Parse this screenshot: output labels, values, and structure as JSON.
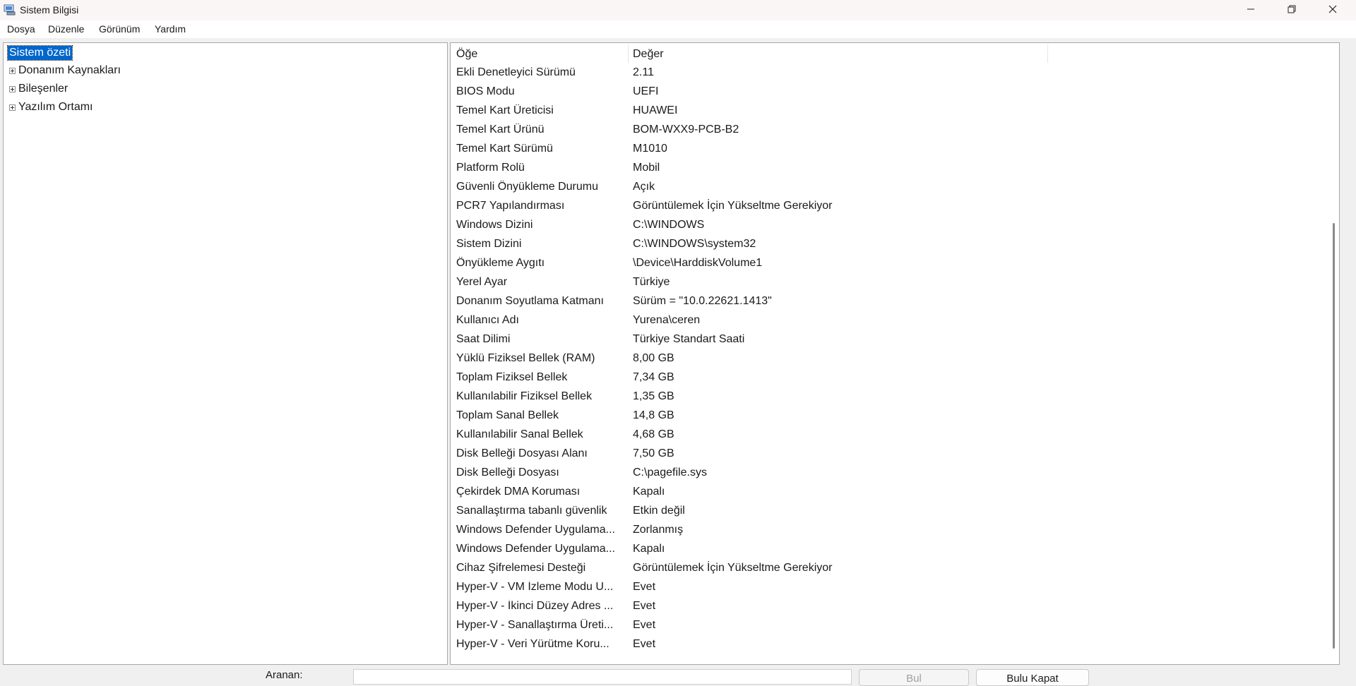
{
  "window": {
    "title": "Sistem Bilgisi",
    "app_icon": "system-information-icon",
    "controls": [
      "minimize-icon",
      "maximize-icon",
      "close-icon"
    ]
  },
  "menu": [
    "Dosya",
    "Düzenle",
    "Görünüm",
    "Yardım"
  ],
  "tree": {
    "root": "Sistem özeti",
    "children": [
      "Donanım Kaynakları",
      "Bileşenler",
      "Yazılım Ortamı"
    ]
  },
  "table": {
    "columns": [
      "Öğe",
      "Değer"
    ],
    "rows": [
      [
        "Ekli Denetleyici Sürümü",
        "2.11"
      ],
      [
        "BIOS Modu",
        "UEFI"
      ],
      [
        "Temel Kart Üreticisi",
        "HUAWEI"
      ],
      [
        "Temel Kart Ürünü",
        "BOM-WXX9-PCB-B2"
      ],
      [
        "Temel Kart Sürümü",
        "M1010"
      ],
      [
        "Platform Rolü",
        "Mobil"
      ],
      [
        "Güvenli Önyükleme Durumu",
        "Açık"
      ],
      [
        "PCR7 Yapılandırması",
        "Görüntülemek İçin Yükseltme Gerekiyor"
      ],
      [
        "Windows Dizini",
        "C:\\WINDOWS"
      ],
      [
        "Sistem Dizini",
        "C:\\WINDOWS\\system32"
      ],
      [
        "Önyükleme Aygıtı",
        "\\Device\\HarddiskVolume1"
      ],
      [
        "Yerel Ayar",
        "Türkiye"
      ],
      [
        "Donanım Soyutlama Katmanı",
        "Sürüm = \"10.0.22621.1413\""
      ],
      [
        "Kullanıcı Adı",
        "Yurena\\ceren"
      ],
      [
        "Saat Dilimi",
        "Türkiye Standart Saati"
      ],
      [
        "Yüklü Fiziksel Bellek (RAM)",
        "8,00 GB"
      ],
      [
        "Toplam Fiziksel Bellek",
        "7,34 GB"
      ],
      [
        "Kullanılabilir Fiziksel Bellek",
        "1,35 GB"
      ],
      [
        "Toplam Sanal Bellek",
        "14,8 GB"
      ],
      [
        "Kullanılabilir Sanal Bellek",
        "4,68 GB"
      ],
      [
        "Disk Belleği Dosyası Alanı",
        "7,50 GB"
      ],
      [
        "Disk Belleği Dosyası",
        "C:\\pagefile.sys"
      ],
      [
        "Çekirdek DMA Koruması",
        "Kapalı"
      ],
      [
        "Sanallaştırma tabanlı güvenlik",
        "Etkin değil"
      ],
      [
        "Windows Defender Uygulama...",
        "Zorlanmış"
      ],
      [
        "Windows Defender Uygulama...",
        "Kapalı"
      ],
      [
        "Cihaz Şifrelemesi Desteği",
        "Görüntülemek İçin Yükseltme Gerekiyor"
      ],
      [
        "Hyper-V - VM İzleme Modu U...",
        "Evet"
      ],
      [
        "Hyper-V - İkinci Düzey Adres ...",
        "Evet"
      ],
      [
        "Hyper-V - Sanallaştırma Üreti...",
        "Evet"
      ],
      [
        "Hyper-V - Veri Yürütme Koru...",
        "Evet"
      ]
    ]
  },
  "find": {
    "label": "Aranan:",
    "value": "",
    "find_button": "Bul",
    "close_find_button": "Bulu Kapat"
  }
}
